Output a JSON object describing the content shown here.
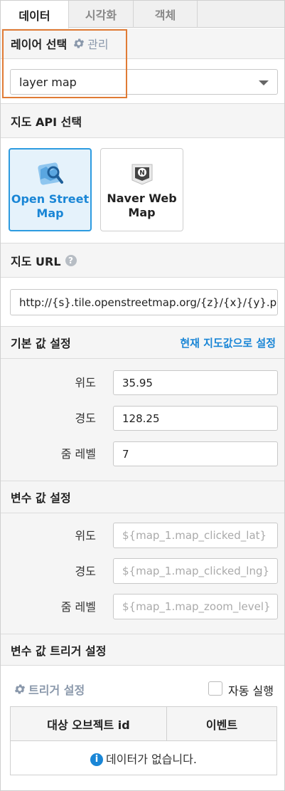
{
  "tabs": [
    {
      "label": "데이터",
      "active": true
    },
    {
      "label": "시각화",
      "active": false
    },
    {
      "label": "객체",
      "active": false
    }
  ],
  "layer_section": {
    "title": "레이어 선택",
    "manage_label": "관리",
    "manage_icon": "gear-icon",
    "select_value": "layer map",
    "highlight_color": "#e07b35"
  },
  "api_section": {
    "title": "지도 API 선택",
    "options": [
      {
        "label_line1": "Open Street",
        "label_line2": "Map",
        "selected": true,
        "icon": "openstreetmap-icon"
      },
      {
        "label_line1": "Naver Web",
        "label_line2": "Map",
        "selected": false,
        "icon": "naver-map-icon"
      }
    ]
  },
  "url_section": {
    "title": "지도 URL",
    "help_icon": "question-icon",
    "value": "http://{s}.tile.openstreetmap.org/{z}/{x}/{y}.png"
  },
  "default_section": {
    "title": "기본 값 설정",
    "action_label": "현재 지도값으로 설정",
    "fields": [
      {
        "label": "위도",
        "value": "35.95"
      },
      {
        "label": "경도",
        "value": "128.25"
      },
      {
        "label": "줌 레벨",
        "value": "7"
      }
    ]
  },
  "variable_section": {
    "title": "변수 값 설정",
    "fields": [
      {
        "label": "위도",
        "placeholder": "${map_1.map_clicked_lat}"
      },
      {
        "label": "경도",
        "placeholder": "${map_1.map_clicked_lng}"
      },
      {
        "label": "줌 레벨",
        "placeholder": "${map_1.map_zoom_level}"
      }
    ]
  },
  "trigger_section": {
    "title": "변수 값 트리거 설정",
    "settings_label": "트리거 설정",
    "auto_run_label": "자동 실행",
    "auto_run_checked": false,
    "table": {
      "headers": [
        "대상 오브젝트 id",
        "이벤트"
      ],
      "empty_message": "데이터가 없습니다."
    }
  },
  "colors": {
    "accent": "#1a86d6",
    "selected_bg": "#e5f2fb",
    "link_gray": "#8a98ab"
  }
}
